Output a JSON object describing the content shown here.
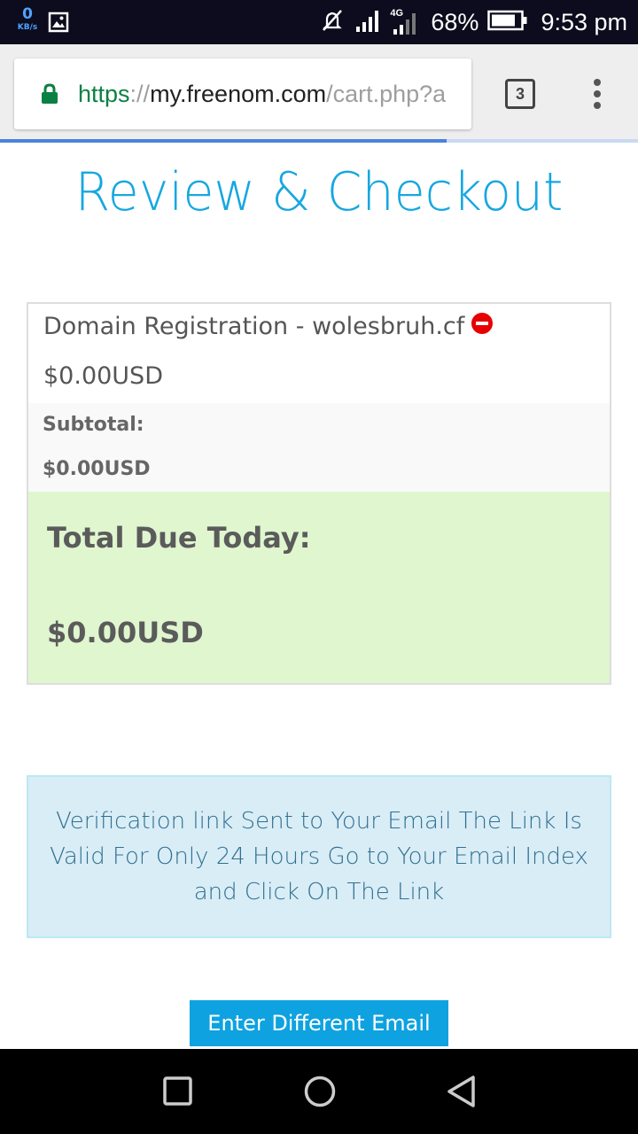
{
  "status_bar": {
    "net_speed": "0",
    "net_unit": "KB/s",
    "network_type": "4G",
    "battery": "68%",
    "time": "9:53 pm"
  },
  "browser": {
    "url_scheme": "https",
    "url_separator": "://",
    "url_host": "my.freenom.com",
    "url_path": "/cart.php?a",
    "tab_count": "3",
    "load_progress": 0.7
  },
  "page": {
    "title": "Review & Checkout",
    "cart": {
      "item_name": "Domain Registration - wolesbruh.cf",
      "item_price": "$0.00USD",
      "subtotal_label": "Subtotal:",
      "subtotal_value": "$0.00USD",
      "total_label": "Total Due Today:",
      "total_value": "$0.00USD"
    },
    "alert": "Verification link Sent to Your Email The Link Is Valid For Only 24 Hours Go to Your Email Index and Click On The Link",
    "button_label": "Enter Different Email"
  },
  "colors": {
    "accent": "#16a7e0",
    "button": "#0ea2e0",
    "total_bg": "#dff6cf",
    "alert_bg": "#d9edf7",
    "remove_icon": "#e60000"
  },
  "icons": {
    "status": [
      "image-icon",
      "mute-icon",
      "signal-icon",
      "battery-icon"
    ],
    "browser": [
      "lock-icon",
      "menu-icon"
    ],
    "cart": [
      "remove-icon"
    ],
    "nav": [
      "recents-icon",
      "home-icon",
      "back-icon"
    ]
  }
}
